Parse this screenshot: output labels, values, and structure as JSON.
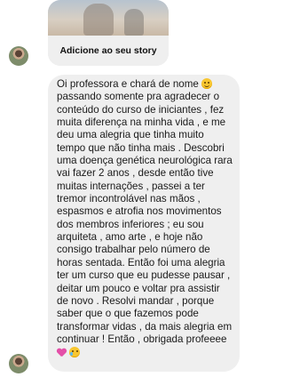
{
  "story": {
    "caption": "Adicione ao seu story"
  },
  "message": {
    "line_1": "Oi professora e chará de nome ",
    "body": "passando somente pra agradecer o\nconteúdo do curso de iniciantes , fez\nmuita diferença na minha vida , e me\ndeu uma alegria que tinha muito\ntempo que não tinha mais . Descobri\numa doença genética neurológica rara\nvai fazer 2 anos , desde então tive\nmuitas internações , passei a ter\ntremor incontrolável nas mãos ,\nespasmos e atrofia nos movimentos\ndos membros inferiores ; eu sou\narquiteta , amo arte , e hoje não\nconsigo trabalhar pelo número de\nhoras sentada. Então foi uma alegria\nter um curso que eu pudesse pausar ,\ndeitar um pouco e voltar pra assistir\nde novo . Resolvi mandar , porque\nsaber que o que fazemos pode\ntransformar vidas , da mais alegria em\ncontinuar ! Então , obrigada profeeee",
    "emojis": [
      "smiling-face-icon",
      "two-hearts-icon",
      "smiling-face-with-tear-icon"
    ]
  }
}
